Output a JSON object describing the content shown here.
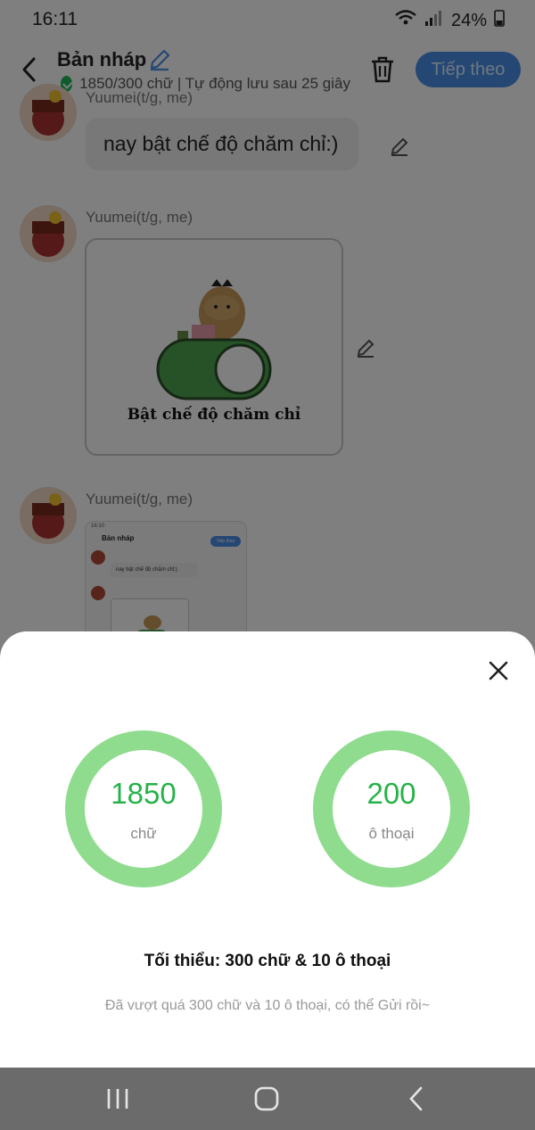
{
  "status_bar": {
    "time": "16:11",
    "battery": "24%"
  },
  "header": {
    "title": "Bản nháp",
    "subtitle": "1850/300 chữ | Tự động lưu sau 25 giây",
    "next_label": "Tiếp theo"
  },
  "chat": {
    "messages": [
      {
        "sender": "Yuumei(t/g, me)",
        "text": "nay bật chế độ chăm chỉ:)"
      },
      {
        "sender": "Yuumei(t/g, me)",
        "sticker_caption": "Bật chế độ chăm chỉ"
      },
      {
        "sender": "Yuumei(t/g, me)",
        "thumb": {
          "time": "16:10",
          "title": "Bản nháp",
          "next": "Tiếp theo",
          "text": "nay bật chế độ chăm chỉ:)"
        }
      }
    ]
  },
  "sheet": {
    "stats": [
      {
        "value": "1850",
        "unit": "chữ"
      },
      {
        "value": "200",
        "unit": "ô thoại"
      }
    ],
    "minimum": "Tối thiểu: 300 chữ & 10 ô thoại",
    "hint": "Đã vượt quá 300 chữ và 10 ô thoại, có thể Gửi rồi~"
  },
  "colors": {
    "accent_blue": "#4a8fe8",
    "ring_green": "#8fdc8f",
    "number_green": "#27b24a"
  }
}
